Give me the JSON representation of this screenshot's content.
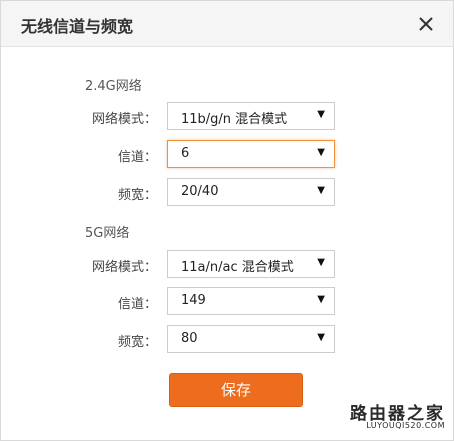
{
  "dialog": {
    "title": "无线信道与频宽"
  },
  "section_24g": {
    "title": "2.4G网络",
    "network_mode_label": "网络模式：",
    "network_mode_value": "11b/g/n 混合模式",
    "channel_label": "信道：",
    "channel_value": "6",
    "bandwidth_label": "频宽：",
    "bandwidth_value": "20/40"
  },
  "section_5g": {
    "title": "5G网络",
    "network_mode_label": "网络模式：",
    "network_mode_value": "11a/n/ac 混合模式",
    "channel_label": "信道：",
    "channel_value": "149",
    "bandwidth_label": "频宽：",
    "bandwidth_value": "80"
  },
  "actions": {
    "save_label": "保存"
  },
  "watermark": {
    "main": "路由器之家",
    "sub": "LUYOUQI520.COM"
  },
  "icons": {
    "close": "close-icon",
    "dropdown": "chevron-down-icon"
  },
  "colors": {
    "accent": "#ed6c1e",
    "focus_border": "#f0903a",
    "header_bg": "#f5f5f5"
  }
}
